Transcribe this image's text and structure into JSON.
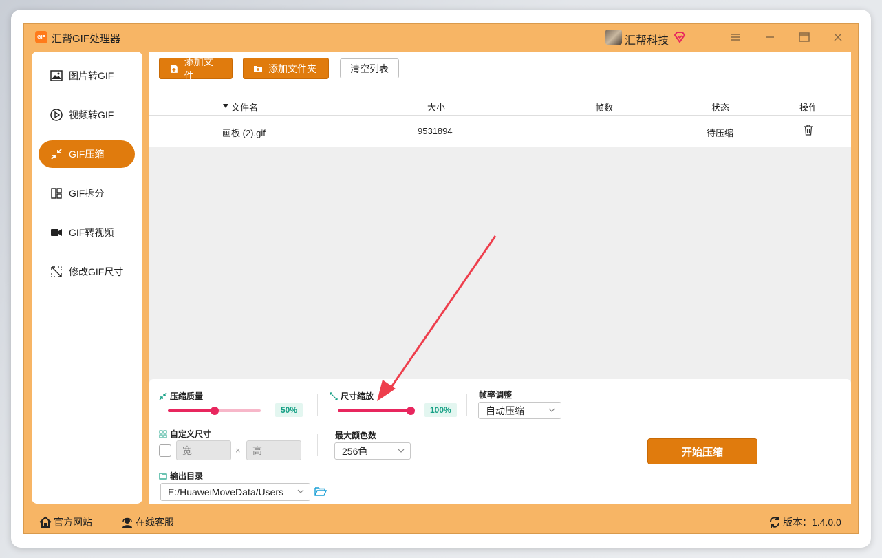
{
  "app": {
    "title": "汇帮GIF处理器",
    "logo_text": "GIF",
    "user_name": "汇帮科技"
  },
  "sidebar": {
    "items": [
      {
        "label": "图片转GIF",
        "icon": "image-icon",
        "active": false
      },
      {
        "label": "视频转GIF",
        "icon": "play-icon",
        "active": false
      },
      {
        "label": "GIF压缩",
        "icon": "compress-icon",
        "active": true
      },
      {
        "label": "GIF拆分",
        "icon": "split-icon",
        "active": false
      },
      {
        "label": "GIF转视频",
        "icon": "video-camera-icon",
        "active": false
      },
      {
        "label": "修改GIF尺寸",
        "icon": "resize-icon",
        "active": false
      }
    ]
  },
  "toolbar": {
    "add_file": "添加文件",
    "add_folder": "添加文件夹",
    "clear_list": "清空列表"
  },
  "table": {
    "columns": [
      "文件名",
      "大小",
      "帧数",
      "状态",
      "操作"
    ],
    "rows": [
      {
        "name": "画板 (2).gif",
        "size": "9531894",
        "frames": "",
        "status": "待压缩"
      }
    ]
  },
  "settings": {
    "quality_label": "压缩质量",
    "quality_value": "50%",
    "quality_fraction": 0.5,
    "scale_label": "尺寸缩放",
    "scale_value": "100%",
    "scale_fraction": 1.0,
    "framerate_label": "帧率调整",
    "framerate_selected": "自动压缩",
    "custom_size_label": "自定义尺寸",
    "width_placeholder": "宽",
    "height_placeholder": "高",
    "times_symbol": "×",
    "max_colors_label": "最大颜色数",
    "max_colors_selected": "256色",
    "output_dir_label": "输出目录",
    "output_dir_value": "E:/HuaweiMoveData/Users",
    "start_button": "开始压缩"
  },
  "footer": {
    "website": "官方网站",
    "support": "在线客服",
    "version": "版本：1.4.0.0"
  },
  "colors": {
    "accent": "#e07b0d",
    "frame": "#f7b565",
    "slider": "#e8265e",
    "teal": "#16a085"
  }
}
